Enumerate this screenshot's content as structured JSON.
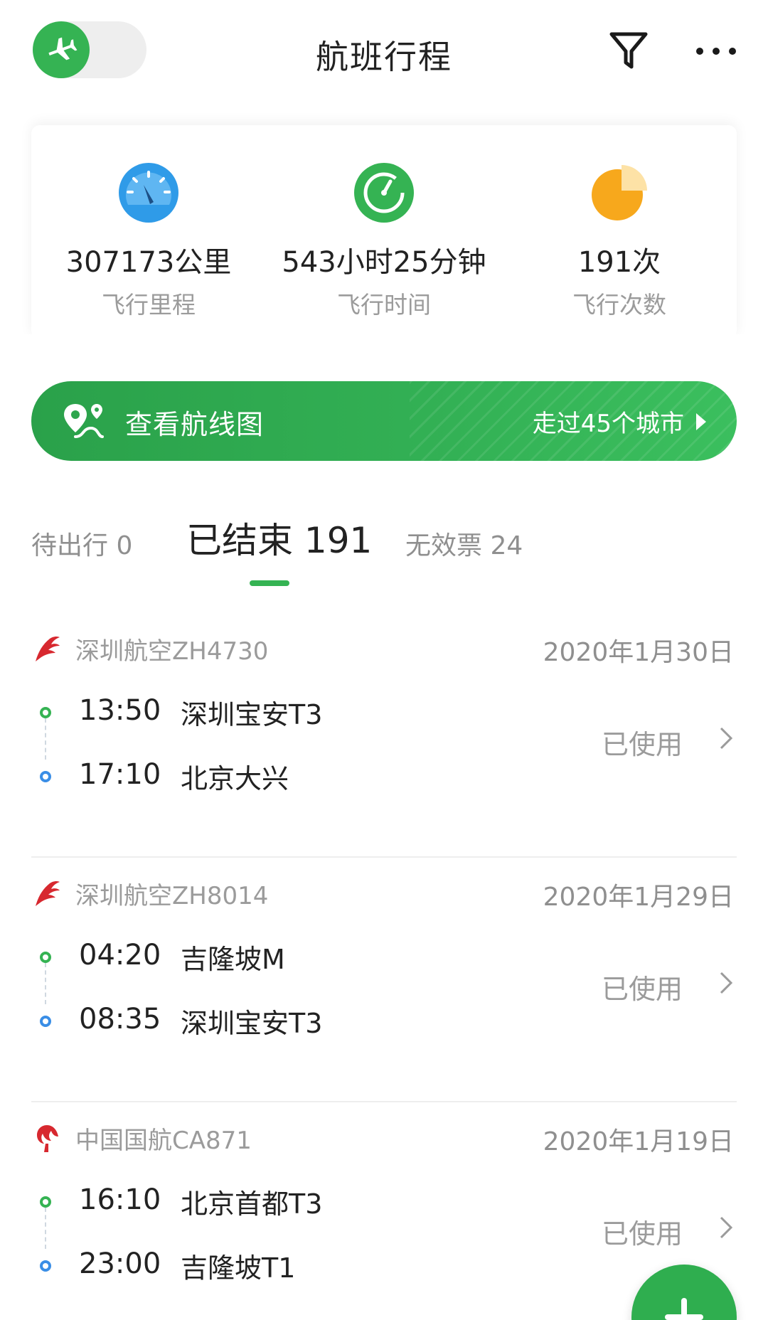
{
  "header": {
    "title": "航班行程",
    "icons": {
      "toggle": "plane-icon",
      "filter": "filter-icon",
      "more": "more-icon"
    }
  },
  "stats": [
    {
      "value": "307173公里",
      "label": "飞行里程",
      "icon": "speedometer-icon",
      "color": "#2f9be8"
    },
    {
      "value": "543小时25分钟",
      "label": "飞行时间",
      "icon": "clock-icon",
      "color": "#35b353"
    },
    {
      "value": "191次",
      "label": "飞行次数",
      "icon": "pie-chart-icon",
      "color": "#f7a81c"
    }
  ],
  "route_banner": {
    "label": "查看航线图",
    "cities": "走过45个城市"
  },
  "tabs": [
    {
      "label": "待出行 0",
      "active": false
    },
    {
      "label": "已结束 191",
      "active": true
    },
    {
      "label": "无效票 24",
      "active": false
    }
  ],
  "flights": [
    {
      "airline": "深圳航空ZH4730",
      "date": "2020年1月30日",
      "logo": "shenzhen-airlines-logo",
      "depart": {
        "time": "13:50",
        "airport": "深圳宝安T3"
      },
      "arrive": {
        "time": "17:10",
        "airport": "北京大兴"
      },
      "status": "已使用"
    },
    {
      "airline": "深圳航空ZH8014",
      "date": "2020年1月29日",
      "logo": "shenzhen-airlines-logo",
      "depart": {
        "time": "04:20",
        "airport": "吉隆坡M"
      },
      "arrive": {
        "time": "08:35",
        "airport": "深圳宝安T3"
      },
      "status": "已使用"
    },
    {
      "airline": "中国国航CA871",
      "date": "2020年1月19日",
      "logo": "air-china-logo",
      "depart": {
        "time": "16:10",
        "airport": "北京首都T3"
      },
      "arrive": {
        "time": "23:00",
        "airport": "吉隆坡T1"
      },
      "status": "已使用"
    }
  ],
  "colors": {
    "brand_green": "#35b353",
    "arrival_blue": "#3a8ee6",
    "muted_text": "#9b9b9b"
  },
  "fab": {
    "icon": "plus-icon"
  }
}
